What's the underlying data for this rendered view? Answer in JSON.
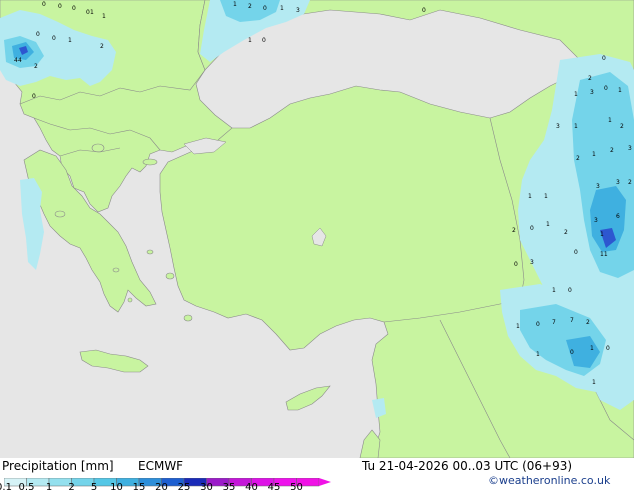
{
  "footer": {
    "title": "Precipitation [mm]",
    "model": "ECMWF",
    "validity": "Tu 21-04-2026 00..03 UTC (06+93)",
    "credit": "©weatheronline.co.uk"
  },
  "legend": {
    "ticks": [
      "0.1",
      "0.5",
      "1",
      "2",
      "5",
      "10",
      "15",
      "20",
      "25",
      "30",
      "35",
      "40",
      "45",
      "50"
    ],
    "colors": [
      "#d6f3f7",
      "#b4eaf2",
      "#94e0ee",
      "#74d4ea",
      "#54c7e6",
      "#3fb0e0",
      "#2d8fda",
      "#1e5fd0",
      "#1a2bb8",
      "#9b1cc9",
      "#c417d8",
      "#dd13e6",
      "#ee12ec",
      "#f012e6"
    ]
  },
  "map": {
    "colors": {
      "sea": "#e6e6e6",
      "land": "#c8f4a0",
      "border": "#8a8a8a",
      "rain_light": "#b4eaf2",
      "rain_mid": "#74d4ea",
      "rain_heavy": "#3fb0e0",
      "rain_max": "#2d57d0"
    },
    "labels": [
      "4",
      "1",
      "2",
      "0",
      "1",
      "3",
      "1",
      "0",
      "0",
      "0",
      "0",
      "0",
      "1",
      "0",
      "0",
      "1",
      "2",
      "1",
      "4",
      "2",
      "0",
      "0",
      "0",
      "2",
      "3",
      "0",
      "1",
      "1",
      "3",
      "1",
      "1",
      "2",
      "1",
      "2",
      "3",
      "2",
      "3",
      "3",
      "2",
      "6",
      "3",
      "1",
      "1",
      "1",
      "1",
      "2",
      "0",
      "0",
      "1",
      "0",
      "3",
      "1",
      "0",
      "7",
      "7",
      "2",
      "1",
      "0",
      "1",
      "0",
      "1",
      "2",
      "0",
      "11"
    ]
  }
}
